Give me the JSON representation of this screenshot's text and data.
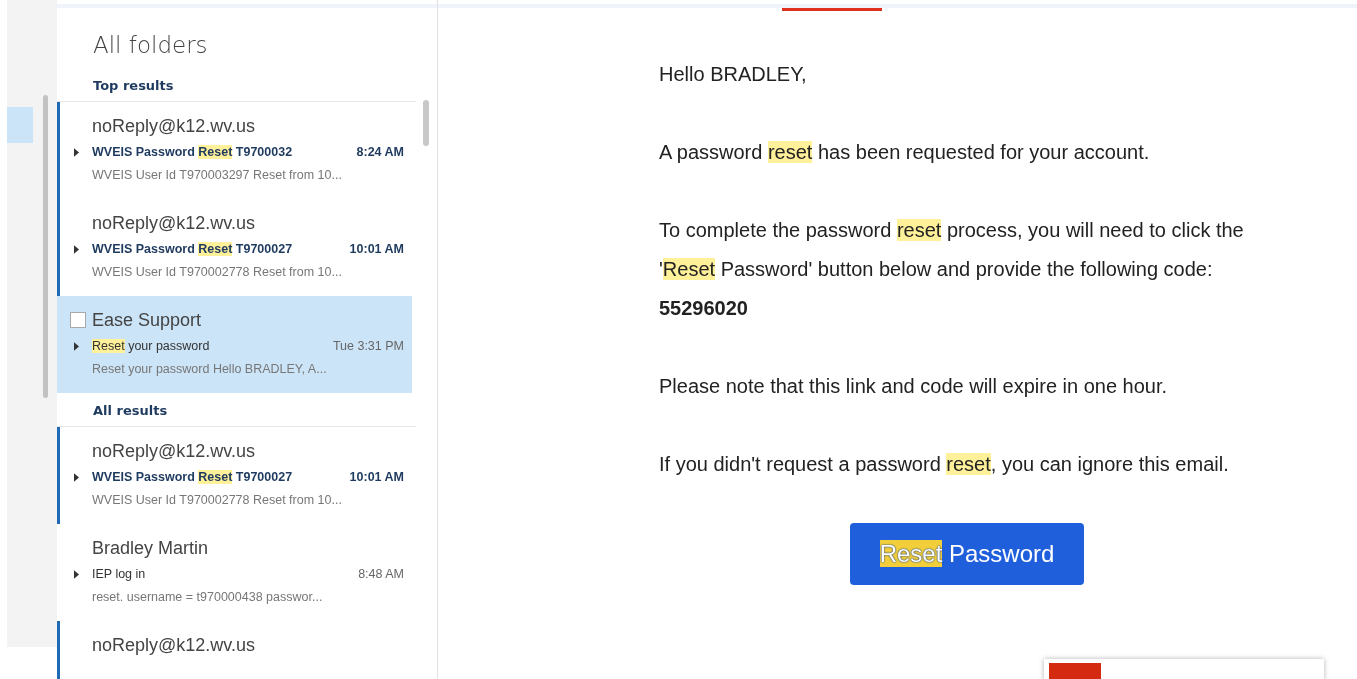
{
  "folder_title": "All folders",
  "sections": [
    {
      "title": "Top results",
      "messages": [
        {
          "sender": "noReply@k12.wv.us",
          "subject": [
            {
              "text": "WVEIS Password ",
              "highlighted": false
            },
            {
              "text": "Reset",
              "highlighted": true
            },
            {
              "text": " T9700032",
              "highlighted": false
            }
          ],
          "time": "8:24 AM",
          "preview": "WVEIS User Id T970003297 Reset from 10...",
          "unread": true,
          "selected": false
        },
        {
          "sender": "noReply@k12.wv.us",
          "subject": [
            {
              "text": "WVEIS Password ",
              "highlighted": false
            },
            {
              "text": "Reset",
              "highlighted": true
            },
            {
              "text": " T9700027",
              "highlighted": false
            }
          ],
          "time": "10:01 AM",
          "preview": "WVEIS User Id T970002778 Reset from 10...",
          "unread": true,
          "selected": false
        },
        {
          "sender": "Ease Support",
          "subject": [
            {
              "text": "Reset",
              "highlighted": true
            },
            {
              "text": " your password",
              "highlighted": false
            }
          ],
          "time": "Tue 3:31 PM",
          "preview": "Reset your password    Hello BRADLEY,  A...",
          "unread": false,
          "selected": true
        }
      ]
    },
    {
      "title": "All results",
      "messages": [
        {
          "sender": "noReply@k12.wv.us",
          "subject": [
            {
              "text": "WVEIS Password ",
              "highlighted": false
            },
            {
              "text": "Reset",
              "highlighted": true
            },
            {
              "text": " T9700027",
              "highlighted": false
            }
          ],
          "time": "10:01 AM",
          "preview": "WVEIS User Id T970002778 Reset from 10...",
          "unread": true,
          "selected": false
        },
        {
          "sender": "Bradley Martin",
          "subject": [
            {
              "text": "IEP log in",
              "highlighted": false
            }
          ],
          "time": "8:48 AM",
          "preview": "reset.   username = t970000438  passwor...",
          "unread": false,
          "selected": false
        },
        {
          "sender": "noReply@k12.wv.us",
          "unread": true,
          "selected": false
        }
      ]
    }
  ],
  "email": {
    "paragraphs": [
      [
        {
          "text": "Hello BRADLEY,",
          "highlighted": false
        }
      ],
      [
        {
          "text": "A password ",
          "highlighted": false
        },
        {
          "text": "reset",
          "highlighted": true
        },
        {
          "text": " has been requested for your account.",
          "highlighted": false
        }
      ],
      [
        {
          "text": "To complete the password ",
          "highlighted": false
        },
        {
          "text": "reset",
          "highlighted": true
        },
        {
          "text": " process, you will need to click the '",
          "highlighted": false
        },
        {
          "text": "Reset",
          "highlighted": true
        },
        {
          "text": " Password' button below and provide the following code: **55296020**",
          "highlighted": false
        }
      ],
      [
        {
          "text": "Please note that this link and code will expire in one hour.",
          "highlighted": false
        }
      ],
      [
        {
          "text": "If you didn't request a password ",
          "highlighted": false
        },
        {
          "text": "reset",
          "highlighted": true
        },
        {
          "text": ", you can ignore this email.",
          "highlighted": false
        }
      ]
    ],
    "button": [
      {
        "text": "Reset",
        "highlighted": true
      },
      {
        "text": " Password",
        "highlighted": false
      }
    ]
  }
}
